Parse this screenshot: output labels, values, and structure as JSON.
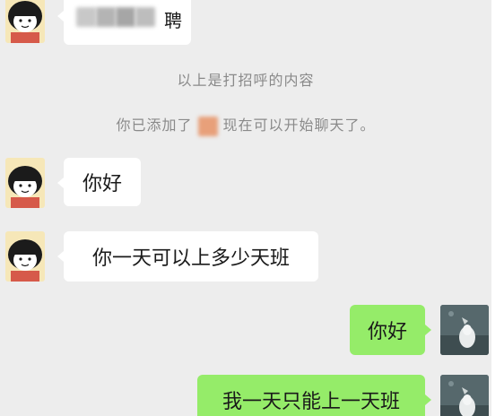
{
  "top_message": {
    "visible_fragment": "聘"
  },
  "system_notices": {
    "greeting_notice": "以上是打招呼的内容",
    "added_notice_before": "你已添加了",
    "added_notice_after": "现在可以开始聊天了。"
  },
  "messages": [
    {
      "side": "in",
      "text": "你好"
    },
    {
      "side": "in",
      "text": "你一天可以上多少天班"
    },
    {
      "side": "out",
      "text": "你好"
    },
    {
      "side": "out",
      "text": "我一天只能上一天班"
    }
  ],
  "colors": {
    "chat_background": "#ededed",
    "incoming_bubble": "#ffffff",
    "outgoing_bubble": "#95ec69",
    "system_text": "#8a8a8a",
    "redacted_name": "#e8a07a"
  },
  "icons": {
    "contact_avatar": "cartoon-girl-avatar-icon",
    "self_avatar": "photo-avatar-icon"
  }
}
